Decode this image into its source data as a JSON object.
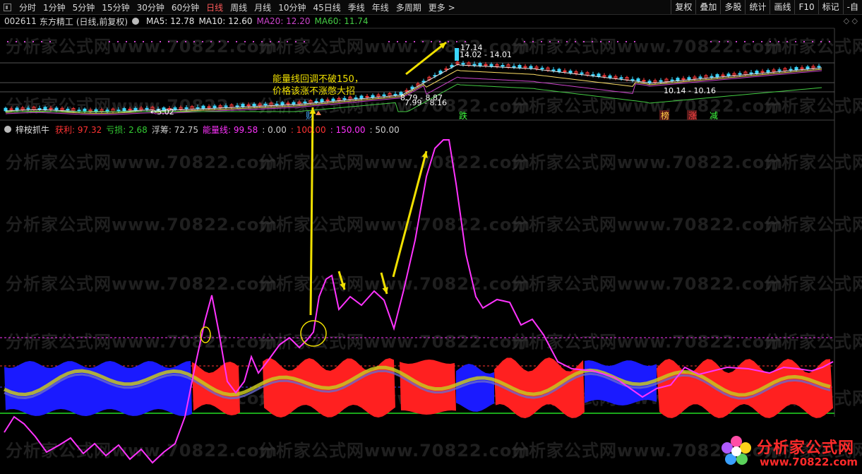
{
  "toolbar": {
    "periods": [
      "分时",
      "1分钟",
      "5分钟",
      "15分钟",
      "30分钟",
      "60分钟",
      "日线",
      "周线",
      "月线",
      "10分钟",
      "45日线",
      "季线",
      "年线",
      "多周期"
    ],
    "active_period": "日线",
    "more_label": "更多",
    "right_buttons": [
      "复权",
      "叠加",
      "多股",
      "统计",
      "画线",
      "F10",
      "标记",
      "-自"
    ]
  },
  "stock": {
    "code": "002611",
    "name": "东方精工",
    "mode": "(日线,前复权)",
    "ma": [
      {
        "label": "MA5:",
        "value": "12.78",
        "color": "#e8e8e8"
      },
      {
        "label": "MA10:",
        "value": "12.60",
        "color": "#e8e8e8"
      },
      {
        "label": "MA20:",
        "value": "12.20",
        "color": "#cc44cc"
      },
      {
        "label": "MA60:",
        "value": "11.74",
        "color": "#44cc44"
      }
    ]
  },
  "price_labels": {
    "high": "17.14",
    "range1": "14.02 - 14.01",
    "range2": "10.14 - 10.16",
    "low": "5.02",
    "mid1": "8.79 - 8.87",
    "mid2": "7.99 - 8.16"
  },
  "signals": [
    {
      "text": "财",
      "color": "#44aaff"
    },
    {
      "text": "跌",
      "color": "#44ff44"
    },
    {
      "text": "榜",
      "color": "#ffcc44"
    },
    {
      "text": "涨",
      "color": "#ff4444"
    },
    {
      "text": "减",
      "color": "#44ff44"
    }
  ],
  "indicator": {
    "name": "梓桉抓牛",
    "items": [
      {
        "label": "获利:",
        "value": "97.32",
        "color": "#ff3333"
      },
      {
        "label": "亏损:",
        "value": "2.68",
        "color": "#33cc33"
      },
      {
        "label": "浮筹:",
        "value": "72.75",
        "color": "#cccccc"
      },
      {
        "label": "能量线:",
        "value": "99.58",
        "color": "#ff33ff"
      },
      {
        "label": "",
        "value": "0.00",
        "color": "#cccccc"
      },
      {
        "label": "",
        "value": "100.00",
        "color": "#ff3333"
      },
      {
        "label": "",
        "value": "150.00",
        "color": "#ff33ff"
      },
      {
        "label": "",
        "value": "50.00",
        "color": "#cccccc"
      }
    ]
  },
  "annotation": {
    "line1": "能量线回调不破150，",
    "line2": "价格该涨不涨憋大招"
  },
  "watermark": "分析家公式网www.70822.com",
  "logo": {
    "title": "分析家公式网",
    "url": "www.70822.com"
  },
  "colors": {
    "energy_line": "#ff33ff",
    "profit": "#ff2020",
    "loss": "#1a1aff",
    "float": "#c8c820",
    "annotation": "#f0e000"
  }
}
